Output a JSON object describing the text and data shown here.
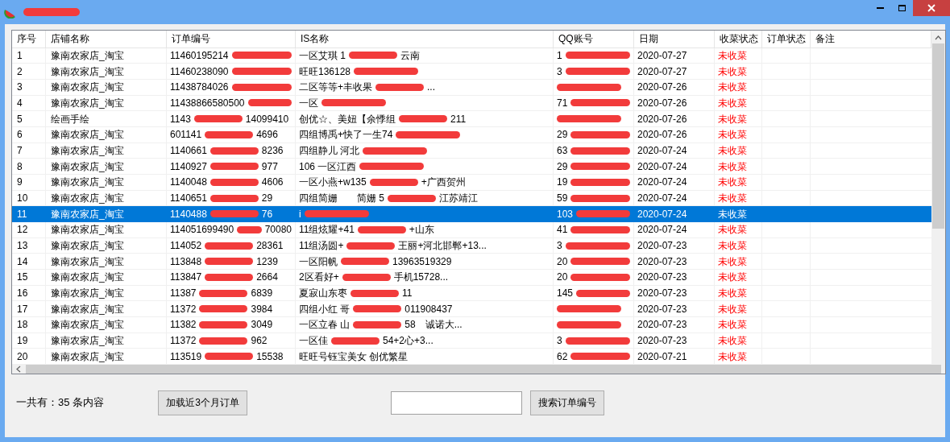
{
  "window": {
    "title_redacted": true
  },
  "table": {
    "columns": [
      "序号",
      "店铺名称",
      "订单编号",
      "IS名称",
      "QQ账号",
      "日期",
      "收菜状态",
      "订单状态",
      "备注"
    ],
    "rows": [
      {
        "no": "1",
        "shop": "豫南农家店_淘宝",
        "order": {
          "text": "11460195214",
          "redacted": true
        },
        "is_name": {
          "text": "一区艾琪 1",
          "redacted": true,
          "tail": "云南"
        },
        "qq": {
          "text": "1",
          "redacted": true
        },
        "date": "2020-07-27",
        "status": "未收菜",
        "selected": false
      },
      {
        "no": "2",
        "shop": "豫南农家店_淘宝",
        "order": {
          "text": "11460238090",
          "redacted": true
        },
        "is_name": {
          "text": "旺旺136128",
          "redacted": true
        },
        "qq": {
          "text": "3",
          "redacted": true
        },
        "date": "2020-07-27",
        "status": "未收菜",
        "selected": false
      },
      {
        "no": "3",
        "shop": "豫南农家店_淘宝",
        "order": {
          "text": "11438784026",
          "redacted": true
        },
        "is_name": {
          "text": "二区等等+丰收果",
          "redacted": true,
          "tail": "..."
        },
        "qq": {
          "redacted": true
        },
        "date": "2020-07-26",
        "status": "未收菜",
        "selected": false
      },
      {
        "no": "4",
        "shop": "豫南农家店_淘宝",
        "order": {
          "text": "11438866580500",
          "redacted": true
        },
        "is_name": {
          "text": "一区",
          "redacted": true
        },
        "qq": {
          "text": "71",
          "redacted": true
        },
        "date": "2020-07-26",
        "status": "未收菜",
        "selected": false
      },
      {
        "no": "5",
        "shop": "绘画手绘",
        "order": {
          "text": "1143",
          "redacted": true,
          "tail": "14099410"
        },
        "is_name": {
          "text": "创优☆、美妞【余悸组",
          "redacted": true,
          "tail": "211"
        },
        "qq": {
          "redacted": true
        },
        "date": "2020-07-26",
        "status": "未收菜",
        "selected": false
      },
      {
        "no": "6",
        "shop": "豫南农家店_淘宝",
        "order": {
          "text": "601141",
          "redacted": true,
          "tail": "4696"
        },
        "is_name": {
          "text": "四组博禹+快了一生74",
          "redacted": true
        },
        "qq": {
          "text": "29",
          "redacted": true
        },
        "date": "2020-07-26",
        "status": "未收菜",
        "selected": false
      },
      {
        "no": "7",
        "shop": "豫南农家店_淘宝",
        "order": {
          "text": "1140661",
          "redacted": true,
          "tail": "8236"
        },
        "is_name": {
          "text": "四组静儿 河北",
          "redacted": true
        },
        "qq": {
          "text": "63",
          "redacted": true
        },
        "date": "2020-07-24",
        "status": "未收菜",
        "selected": false
      },
      {
        "no": "8",
        "shop": "豫南农家店_淘宝",
        "order": {
          "text": "1140927",
          "redacted": true,
          "tail": "977"
        },
        "is_name": {
          "text": "106 一区江西",
          "redacted": true
        },
        "qq": {
          "text": "29",
          "redacted": true
        },
        "date": "2020-07-24",
        "status": "未收菜",
        "selected": false
      },
      {
        "no": "9",
        "shop": "豫南农家店_淘宝",
        "order": {
          "text": "1140048",
          "redacted": true,
          "tail": "4606"
        },
        "is_name": {
          "text": "一区小燕+w135",
          "redacted": true,
          "tail": "+广西贺州"
        },
        "qq": {
          "text": "19",
          "redacted": true
        },
        "date": "2020-07-24",
        "status": "未收菜",
        "selected": false
      },
      {
        "no": "10",
        "shop": "豫南农家店_淘宝",
        "order": {
          "text": "1140651",
          "redacted": true,
          "tail": "29"
        },
        "is_name": {
          "text": "四组简姗　　简姗 5",
          "redacted": true,
          "tail": "江苏靖江"
        },
        "qq": {
          "text": "59",
          "redacted": true
        },
        "date": "2020-07-24",
        "status": "未收菜",
        "selected": false
      },
      {
        "no": "11",
        "shop": "豫南农家店_淘宝",
        "order": {
          "text": "1140488",
          "redacted": true,
          "tail": "76"
        },
        "is_name": {
          "text": "i",
          "redacted": true
        },
        "qq": {
          "text": "103",
          "redacted": true
        },
        "date": "2020-07-24",
        "status": "未收菜",
        "selected": true
      },
      {
        "no": "12",
        "shop": "豫南农家店_淘宝",
        "order": {
          "text": "114051699490",
          "redacted": true,
          "tail": "70080"
        },
        "is_name": {
          "text": "11组炫耀+41",
          "redacted": true,
          "tail": "+山东"
        },
        "qq": {
          "text": "41",
          "redacted": true
        },
        "date": "2020-07-24",
        "status": "未收菜",
        "selected": false
      },
      {
        "no": "13",
        "shop": "豫南农家店_淘宝",
        "order": {
          "text": "114052",
          "redacted": true,
          "tail": "28361"
        },
        "is_name": {
          "text": "11组汤圆+",
          "redacted": true,
          "tail": "王丽+河北邯郸+13..."
        },
        "qq": {
          "text": "3",
          "redacted": true
        },
        "date": "2020-07-23",
        "status": "未收菜",
        "selected": false
      },
      {
        "no": "14",
        "shop": "豫南农家店_淘宝",
        "order": {
          "text": "113848",
          "redacted": true,
          "tail": "1239"
        },
        "is_name": {
          "text": "一区阳帆",
          "redacted": true,
          "tail": "13963519329"
        },
        "qq": {
          "text": "20",
          "redacted": true
        },
        "date": "2020-07-23",
        "status": "未收菜",
        "selected": false
      },
      {
        "no": "15",
        "shop": "豫南农家店_淘宝",
        "order": {
          "text": "113847",
          "redacted": true,
          "tail": "2664"
        },
        "is_name": {
          "text": "2区看好+",
          "redacted": true,
          "tail": "手机15728..."
        },
        "qq": {
          "text": "20",
          "redacted": true
        },
        "date": "2020-07-23",
        "status": "未收菜",
        "selected": false
      },
      {
        "no": "16",
        "shop": "豫南农家店_淘宝",
        "order": {
          "text": "11387",
          "redacted": true,
          "tail": "6839"
        },
        "is_name": {
          "text": "夏寂山东枣",
          "redacted": true,
          "tail": "11"
        },
        "qq": {
          "text": "145",
          "redacted": true
        },
        "date": "2020-07-23",
        "status": "未收菜",
        "selected": false
      },
      {
        "no": "17",
        "shop": "豫南农家店_淘宝",
        "order": {
          "text": "11372",
          "redacted": true,
          "tail": "3984"
        },
        "is_name": {
          "text": "四组小红 哥",
          "redacted": true,
          "tail": "011908437"
        },
        "qq": {
          "redacted": true
        },
        "date": "2020-07-23",
        "status": "未收菜",
        "selected": false
      },
      {
        "no": "18",
        "shop": "豫南农家店_淘宝",
        "order": {
          "text": "11382",
          "redacted": true,
          "tail": "3049"
        },
        "is_name": {
          "text": " 一区立春 山",
          "redacted": true,
          "tail": "58　诚诺大..."
        },
        "qq": {
          "redacted": true
        },
        "date": "2020-07-23",
        "status": "未收菜",
        "selected": false
      },
      {
        "no": "19",
        "shop": "豫南农家店_淘宝",
        "order": {
          "text": "11372",
          "redacted": true,
          "tail": "962"
        },
        "is_name": {
          "text": "一区佳",
          "redacted": true,
          "tail": "54+2心+3..."
        },
        "qq": {
          "text": "3",
          "redacted": true
        },
        "date": "2020-07-23",
        "status": "未收菜",
        "selected": false
      },
      {
        "no": "20",
        "shop": "豫南农家店_淘宝",
        "order": {
          "text": "113519",
          "redacted": true,
          "tail": "15538"
        },
        "is_name": {
          "text": "旺旺号钰宝美女 创优繁星",
          "redacted": false
        },
        "qq": {
          "text": "62",
          "redacted": true
        },
        "date": "2020-07-21",
        "status": "未收菜",
        "selected": false
      }
    ]
  },
  "footer": {
    "count": "一共有：35 条内容",
    "load_button": "加载近3个月订单",
    "search_button": "搜索订单编号"
  }
}
